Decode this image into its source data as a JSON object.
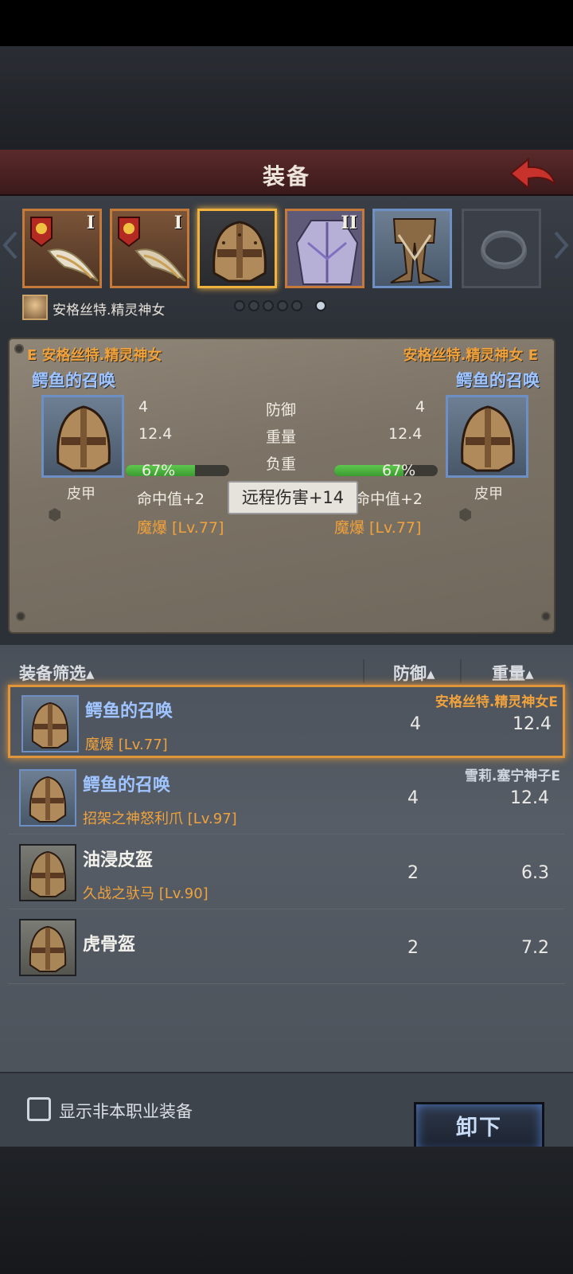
{
  "header": {
    "title": "装备"
  },
  "slots": [
    {
      "tier": "I",
      "icon": "sword-icon"
    },
    {
      "tier": "I",
      "icon": "sword-icon"
    },
    {
      "tier": "",
      "icon": "helmet-icon"
    },
    {
      "tier": "II",
      "icon": "armor-icon"
    },
    {
      "tier": "",
      "icon": "boots-icon"
    },
    {
      "tier": "",
      "icon": "ring-icon"
    }
  ],
  "character": {
    "name": "安格丝特.精灵神女"
  },
  "page_dots": {
    "count": 6,
    "active": 6
  },
  "compare": {
    "left": {
      "owner_tag": "E 安格丝特.精灵神女",
      "name": "鳄鱼的召唤",
      "type": "皮甲",
      "defense": "4",
      "weight": "12.4",
      "load": "67%",
      "load_fraction": 0.67,
      "hit": "命中值+2",
      "rune": "魔爆 [Lv.77]"
    },
    "right": {
      "owner_tag": "安格丝特.精灵神女 E",
      "name": "鳄鱼的召唤",
      "type": "皮甲",
      "defense": "4",
      "weight": "12.4",
      "load": "67%",
      "load_fraction": 0.67,
      "hit": "命中值+2",
      "rune": "魔爆 [Lv.77]"
    },
    "labels": {
      "defense": "防御",
      "weight": "重量",
      "load": "负重"
    },
    "tooltip": "远程伤害+14"
  },
  "list": {
    "headers": {
      "filter": "装备筛选▴",
      "defense": "防御▴",
      "weight": "重量▴"
    },
    "items": [
      {
        "name": "鳄鱼的召唤",
        "rune": "魔爆 [Lv.77]",
        "owner": "安格丝特.精灵神女E",
        "defense": "4",
        "weight": "12.4"
      },
      {
        "name": "鳄鱼的召唤",
        "rune": "招架之神怒利爪 [Lv.97]",
        "owner": "雪莉.塞宁神子E",
        "defense": "4",
        "weight": "12.4"
      },
      {
        "name": "油浸皮盔",
        "rune": "久战之驮马 [Lv.90]",
        "owner": "",
        "defense": "2",
        "weight": "6.3"
      },
      {
        "name": "虎骨盔",
        "rune": "",
        "owner": "",
        "defense": "2",
        "weight": "7.2"
      }
    ]
  },
  "footer": {
    "checkbox_label": "显示非本职业装备",
    "unequip_label": "卸下"
  },
  "colors": {
    "accent_orange": "#f0a23c",
    "item_blue": "#9fc4ff",
    "header_red": "#5b2a2a"
  }
}
